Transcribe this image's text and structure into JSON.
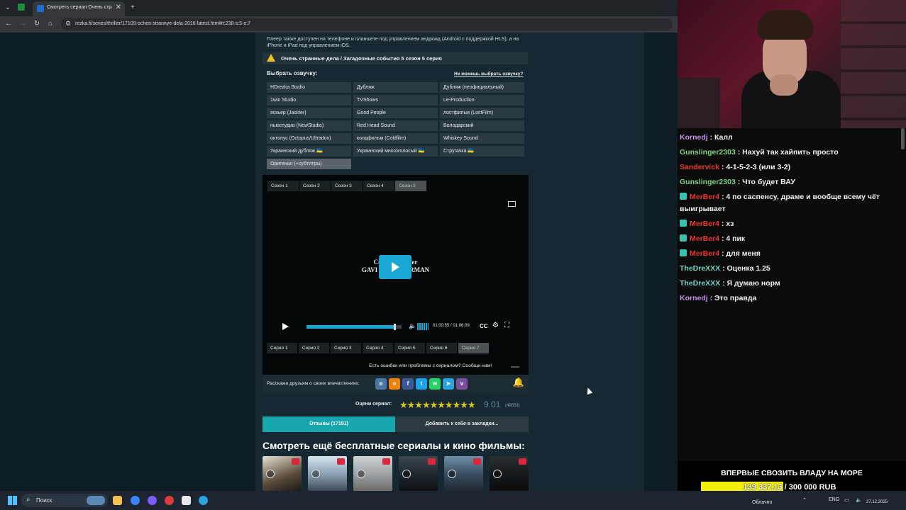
{
  "browser": {
    "tab_title": "Смотреть сериал Очень стра...",
    "url": "rezka.fi/series/thriller/17109-ochen-strannye-dela-2016-latest.html#t:238-s:5-e:7"
  },
  "page": {
    "info_text": "Плеер также доступен на телефоне и планшете под управлением андроид (Android с поддержкой HLS), а на iPhone и iPad под управлением iOS.",
    "warning_title": "Очень странные дела / Загадочные события 5 сезон 5 серия",
    "voice_heading": "Выбрать озвучку:",
    "voice_help_link": "Не можешь выбрать озвучку?",
    "voices": [
      [
        "HDrezka Studio",
        "Дубляж",
        "Дубляж (неофициальный)"
      ],
      [
        "1win Studio",
        "TVShows",
        "Le-Production"
      ],
      [
        "яскьер (Jaskier)",
        "Good People",
        "лостфильм (LostFilm)"
      ],
      [
        "ньюстудио (NewStudio)",
        "Red Head Sound",
        "Володарский"
      ],
      [
        "октопус (Octopus/Ultradox)",
        "колдфильм (Coldfilm)",
        "Whiskey Sound"
      ],
      [
        "Украинский дубляж 🇺🇦",
        "Украинский многоголосый 🇺🇦",
        "Стругачка 🇺🇦"
      ],
      [
        "Оригинал (+субтитры)"
      ]
    ],
    "selected_voice": "Оригинал (+субтитры)",
    "seasons": [
      "Сезон 1",
      "Сезон 2",
      "Сезон 3",
      "Сезон 4",
      "Сезон 5"
    ],
    "selected_season": "Сезон 5",
    "episodes": [
      "Серия 1",
      "Серия 2",
      "Серия 3",
      "Серия 4",
      "Серия 5",
      "Серия 6",
      "Серия 7"
    ],
    "selected_episode": "Серия 7",
    "video_credit_line1": "Co                   er",
    "video_credit_line2": "GAVI                    RMAN",
    "player": {
      "time": "01:00:55 / 01:06:09",
      "progress": 0.921,
      "cc_label": "CC"
    },
    "report_text": "Есть ошибки или проблемы с сериалом? Сообщи нам!",
    "share_label": "Расскажи друзьям о своих впечатлениях:",
    "rate_label": "Оцени сериал:",
    "rating": "9.01",
    "rating_stars": "★★★★★★★★★★",
    "votes": "(49853)",
    "reviews_button": "Отзывы (17151)",
    "bookmark_button": "Добавить к себе в закладки...",
    "more_heading": "Смотреть ещё бесплатные сериалы и кино фильмы:"
  },
  "stream": {
    "chat": [
      {
        "user": "Kornedj",
        "text": " : Калл",
        "color": "#c58ee8",
        "badge": false
      },
      {
        "user": "Gunslinger2303",
        "text": " : Нахуй так хайпить просто",
        "color": "#7bd47f",
        "badge": false
      },
      {
        "user": "Sandervick",
        "text": " : 4-1-5-2-3 (или 3-2)",
        "color": "#e8382e",
        "badge": false
      },
      {
        "user": "Gunslinger2303",
        "text": " : Что будет ВАУ",
        "color": "#7bd47f",
        "badge": false
      },
      {
        "user": "MerBer4",
        "text": " : 4 по саспенсу, драме и вообще всему чёт выигрывает",
        "color": "#e8382e",
        "badge": true
      },
      {
        "user": "MerBer4",
        "text": " : хз",
        "color": "#e8382e",
        "badge": true
      },
      {
        "user": "MerBer4",
        "text": " : 4 пик",
        "color": "#e8382e",
        "badge": true
      },
      {
        "user": "MerBer4",
        "text": " : для меня",
        "color": "#e8382e",
        "badge": true
      },
      {
        "user": "TheDreXXX",
        "text": " : Оценка 1.25",
        "color": "#6fd6c4",
        "badge": false
      },
      {
        "user": "TheDreXXX",
        "text": " : Я думаю норм",
        "color": "#6fd6c4",
        "badge": false
      },
      {
        "user": "Kornedj",
        "text": " : Это правда",
        "color": "#c58ee8",
        "badge": false
      }
    ],
    "goal_title": "ВПЕРВЫЕ СВОЗИТЬ ВЛАДУ НА МОРЕ",
    "goal_amount": "139 337.13 / 300 000 RUB",
    "goal_progress": 0.4645
  },
  "taskbar": {
    "search_placeholder": "Поиск",
    "weather": "Облачно",
    "lang": "ENG",
    "date": "27.12.2025"
  }
}
